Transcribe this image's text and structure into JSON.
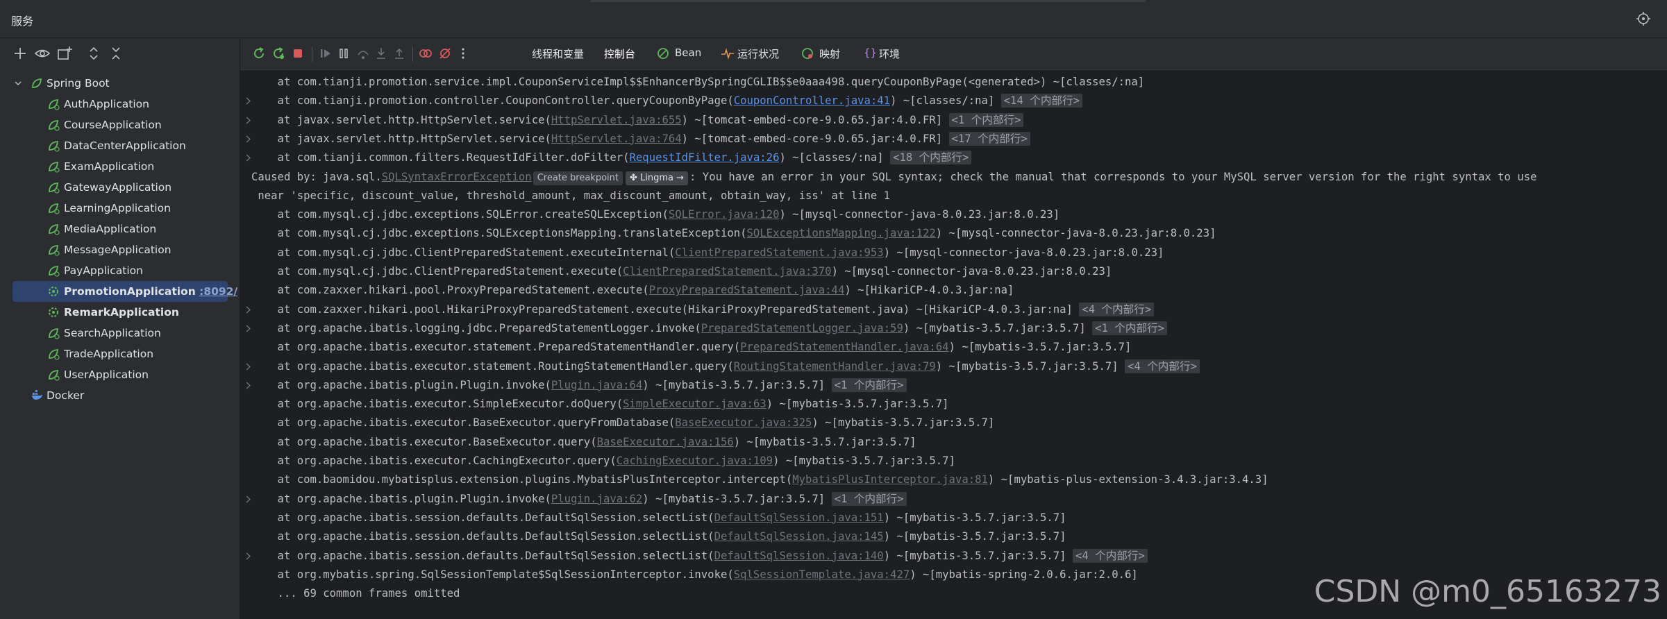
{
  "window": {
    "title": "服务"
  },
  "colors": {
    "accent": "#2e436e",
    "link": "#5a93e6",
    "springGreen": "#5fb85a",
    "stopRed": "#d85a5a"
  },
  "left_toolbar": {
    "icons": [
      "add-icon",
      "eye-icon",
      "new-tab-icon",
      "expand-icon",
      "collapse-icon"
    ]
  },
  "tree": {
    "root": {
      "label": "Spring Boot"
    },
    "apps": [
      {
        "label": "AuthApplication"
      },
      {
        "label": "CourseApplication"
      },
      {
        "label": "DataCenterApplication"
      },
      {
        "label": "ExamApplication"
      },
      {
        "label": "GatewayApplication"
      },
      {
        "label": "LearningApplication"
      },
      {
        "label": "MediaApplication"
      },
      {
        "label": "MessageApplication"
      },
      {
        "label": "PayApplication"
      }
    ],
    "selected": {
      "label": "PromotionApplication",
      "port": ":8092/"
    },
    "after": [
      {
        "label": "RemarkApplication",
        "bold": true
      },
      {
        "label": "SearchApplication"
      },
      {
        "label": "TradeApplication"
      },
      {
        "label": "UserApplication"
      }
    ],
    "docker": {
      "label": "Docker"
    }
  },
  "right_toolbar": {
    "tabs": {
      "threads": "线程和变量",
      "console": "控制台",
      "bean": "Bean",
      "health": "运行状况",
      "mappings": "映射",
      "env": "环境"
    }
  },
  "console": {
    "lines": [
      {
        "chev": false,
        "parts": [
          [
            "t",
            "    at com.tianji.promotion.service.impl.CouponServiceImpl$$EnhancerBySpringCGLIB$$e0aaa498.queryCouponByPage(<generated>) ~[classes/:na]"
          ]
        ]
      },
      {
        "chev": true,
        "parts": [
          [
            "t",
            "    at com.tianji.promotion.controller.CouponController.queryCouponByPage("
          ],
          [
            "l",
            "CouponController.java:41"
          ],
          [
            "t",
            ") ~[classes/:na] "
          ],
          [
            "b",
            "<14 个内部行>"
          ]
        ]
      },
      {
        "chev": true,
        "parts": [
          [
            "t",
            "    at javax.servlet.http.HttpServlet.service("
          ],
          [
            "g",
            "HttpServlet.java:655"
          ],
          [
            "t",
            ") ~[tomcat-embed-core-9.0.65.jar:4.0.FR] "
          ],
          [
            "b",
            "<1 个内部行>"
          ]
        ]
      },
      {
        "chev": true,
        "parts": [
          [
            "t",
            "    at javax.servlet.http.HttpServlet.service("
          ],
          [
            "g",
            "HttpServlet.java:764"
          ],
          [
            "t",
            ") ~[tomcat-embed-core-9.0.65.jar:4.0.FR] "
          ],
          [
            "b",
            "<17 个内部行>"
          ]
        ]
      },
      {
        "chev": true,
        "parts": [
          [
            "t",
            "    at com.tianji.common.filters.RequestIdFilter.doFilter("
          ],
          [
            "l",
            "RequestIdFilter.java:26"
          ],
          [
            "t",
            ") ~[classes/:na] "
          ],
          [
            "b",
            "<18 个内部行>"
          ]
        ]
      },
      {
        "chev": false,
        "parts": [
          [
            "t",
            "Caused by: java.sql."
          ],
          [
            "e",
            "SQLSyntaxErrorException"
          ],
          [
            "p1",
            "Create breakpoint"
          ],
          [
            "p2",
            "✤ Lingma →"
          ],
          [
            "t",
            ": You have an error in your SQL syntax; check the manual that corresponds to your MySQL server version for the right syntax to use"
          ]
        ]
      },
      {
        "chev": false,
        "parts": [
          [
            "t",
            " near 'specific, discount_value, threshold_amount, max_discount_amount, obtain_way, iss' at line 1"
          ]
        ]
      },
      {
        "chev": false,
        "parts": [
          [
            "t",
            "    at com.mysql.cj.jdbc.exceptions.SQLError.createSQLException("
          ],
          [
            "g",
            "SQLError.java:120"
          ],
          [
            "t",
            ") ~[mysql-connector-java-8.0.23.jar:8.0.23]"
          ]
        ]
      },
      {
        "chev": false,
        "parts": [
          [
            "t",
            "    at com.mysql.cj.jdbc.exceptions.SQLExceptionsMapping.translateException("
          ],
          [
            "g",
            "SQLExceptionsMapping.java:122"
          ],
          [
            "t",
            ") ~[mysql-connector-java-8.0.23.jar:8.0.23]"
          ]
        ]
      },
      {
        "chev": false,
        "parts": [
          [
            "t",
            "    at com.mysql.cj.jdbc.ClientPreparedStatement.executeInternal("
          ],
          [
            "g",
            "ClientPreparedStatement.java:953"
          ],
          [
            "t",
            ") ~[mysql-connector-java-8.0.23.jar:8.0.23]"
          ]
        ]
      },
      {
        "chev": false,
        "parts": [
          [
            "t",
            "    at com.mysql.cj.jdbc.ClientPreparedStatement.execute("
          ],
          [
            "g",
            "ClientPreparedStatement.java:370"
          ],
          [
            "t",
            ") ~[mysql-connector-java-8.0.23.jar:8.0.23]"
          ]
        ]
      },
      {
        "chev": false,
        "parts": [
          [
            "t",
            "    at com.zaxxer.hikari.pool.ProxyPreparedStatement.execute("
          ],
          [
            "g",
            "ProxyPreparedStatement.java:44"
          ],
          [
            "t",
            ") ~[HikariCP-4.0.3.jar:na]"
          ]
        ]
      },
      {
        "chev": true,
        "parts": [
          [
            "t",
            "    at com.zaxxer.hikari.pool.HikariProxyPreparedStatement.execute(HikariProxyPreparedStatement.java) ~[HikariCP-4.0.3.jar:na] "
          ],
          [
            "b",
            "<4 个内部行>"
          ]
        ]
      },
      {
        "chev": true,
        "parts": [
          [
            "t",
            "    at org.apache.ibatis.logging.jdbc.PreparedStatementLogger.invoke("
          ],
          [
            "g",
            "PreparedStatementLogger.java:59"
          ],
          [
            "t",
            ") ~[mybatis-3.5.7.jar:3.5.7] "
          ],
          [
            "b",
            "<1 个内部行>"
          ]
        ]
      },
      {
        "chev": false,
        "parts": [
          [
            "t",
            "    at org.apache.ibatis.executor.statement.PreparedStatementHandler.query("
          ],
          [
            "g",
            "PreparedStatementHandler.java:64"
          ],
          [
            "t",
            ") ~[mybatis-3.5.7.jar:3.5.7]"
          ]
        ]
      },
      {
        "chev": true,
        "parts": [
          [
            "t",
            "    at org.apache.ibatis.executor.statement.RoutingStatementHandler.query("
          ],
          [
            "g",
            "RoutingStatementHandler.java:79"
          ],
          [
            "t",
            ") ~[mybatis-3.5.7.jar:3.5.7] "
          ],
          [
            "b",
            "<4 个内部行>"
          ]
        ]
      },
      {
        "chev": true,
        "parts": [
          [
            "t",
            "    at org.apache.ibatis.plugin.Plugin.invoke("
          ],
          [
            "g",
            "Plugin.java:64"
          ],
          [
            "t",
            ") ~[mybatis-3.5.7.jar:3.5.7] "
          ],
          [
            "b",
            "<1 个内部行>"
          ]
        ]
      },
      {
        "chev": false,
        "parts": [
          [
            "t",
            "    at org.apache.ibatis.executor.SimpleExecutor.doQuery("
          ],
          [
            "g",
            "SimpleExecutor.java:63"
          ],
          [
            "t",
            ") ~[mybatis-3.5.7.jar:3.5.7]"
          ]
        ]
      },
      {
        "chev": false,
        "parts": [
          [
            "t",
            "    at org.apache.ibatis.executor.BaseExecutor.queryFromDatabase("
          ],
          [
            "g",
            "BaseExecutor.java:325"
          ],
          [
            "t",
            ") ~[mybatis-3.5.7.jar:3.5.7]"
          ]
        ]
      },
      {
        "chev": false,
        "parts": [
          [
            "t",
            "    at org.apache.ibatis.executor.BaseExecutor.query("
          ],
          [
            "g",
            "BaseExecutor.java:156"
          ],
          [
            "t",
            ") ~[mybatis-3.5.7.jar:3.5.7]"
          ]
        ]
      },
      {
        "chev": false,
        "parts": [
          [
            "t",
            "    at org.apache.ibatis.executor.CachingExecutor.query("
          ],
          [
            "g",
            "CachingExecutor.java:109"
          ],
          [
            "t",
            ") ~[mybatis-3.5.7.jar:3.5.7]"
          ]
        ]
      },
      {
        "chev": false,
        "parts": [
          [
            "t",
            "    at com.baomidou.mybatisplus.extension.plugins.MybatisPlusInterceptor.intercept("
          ],
          [
            "g",
            "MybatisPlusInterceptor.java:81"
          ],
          [
            "t",
            ") ~[mybatis-plus-extension-3.4.3.jar:3.4.3]"
          ]
        ]
      },
      {
        "chev": true,
        "parts": [
          [
            "t",
            "    at org.apache.ibatis.plugin.Plugin.invoke("
          ],
          [
            "g",
            "Plugin.java:62"
          ],
          [
            "t",
            ") ~[mybatis-3.5.7.jar:3.5.7] "
          ],
          [
            "b",
            "<1 个内部行>"
          ]
        ]
      },
      {
        "chev": false,
        "parts": [
          [
            "t",
            "    at org.apache.ibatis.session.defaults.DefaultSqlSession.selectList("
          ],
          [
            "g",
            "DefaultSqlSession.java:151"
          ],
          [
            "t",
            ") ~[mybatis-3.5.7.jar:3.5.7]"
          ]
        ]
      },
      {
        "chev": false,
        "parts": [
          [
            "t",
            "    at org.apache.ibatis.session.defaults.DefaultSqlSession.selectList("
          ],
          [
            "g",
            "DefaultSqlSession.java:145"
          ],
          [
            "t",
            ") ~[mybatis-3.5.7.jar:3.5.7]"
          ]
        ]
      },
      {
        "chev": true,
        "parts": [
          [
            "t",
            "    at org.apache.ibatis.session.defaults.DefaultSqlSession.selectList("
          ],
          [
            "g",
            "DefaultSqlSession.java:140"
          ],
          [
            "t",
            ") ~[mybatis-3.5.7.jar:3.5.7] "
          ],
          [
            "b",
            "<4 个内部行>"
          ]
        ]
      },
      {
        "chev": false,
        "parts": [
          [
            "t",
            "    at org.mybatis.spring.SqlSessionTemplate$SqlSessionInterceptor.invoke("
          ],
          [
            "g",
            "SqlSessionTemplate.java:427"
          ],
          [
            "t",
            ") ~[mybatis-spring-2.0.6.jar:2.0.6]"
          ]
        ]
      },
      {
        "chev": false,
        "parts": [
          [
            "t",
            "    ... 69 common frames omitted"
          ]
        ]
      }
    ]
  },
  "watermark": "CSDN @m0_65163273"
}
